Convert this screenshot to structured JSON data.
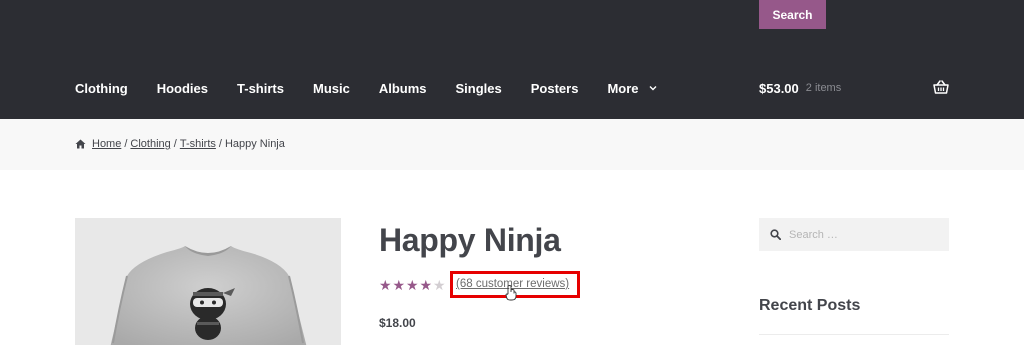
{
  "header": {
    "search_button": "Search",
    "nav": [
      {
        "label": "Clothing"
      },
      {
        "label": "Hoodies"
      },
      {
        "label": "T-shirts"
      },
      {
        "label": "Music"
      },
      {
        "label": "Albums"
      },
      {
        "label": "Singles"
      },
      {
        "label": "Posters"
      },
      {
        "label": "More"
      }
    ],
    "cart": {
      "total": "$53.00",
      "count": "2 items"
    }
  },
  "breadcrumb": {
    "home": "Home",
    "category": "Clothing",
    "subcategory": "T-shirts",
    "separator": "/",
    "current": "Happy Ninja"
  },
  "product": {
    "title": "Happy Ninja",
    "rating": 4,
    "rating_max": 5,
    "reviews_link": "(68 customer reviews)",
    "price": "$18.00"
  },
  "sidebar": {
    "search_placeholder": "Search …",
    "recent_posts_title": "Recent Posts"
  },
  "colors": {
    "header_bg": "#2c2d33",
    "accent": "#96588a",
    "highlight": "#e60000",
    "star_filled": "#96588a",
    "star_empty": "#d3ced2"
  }
}
